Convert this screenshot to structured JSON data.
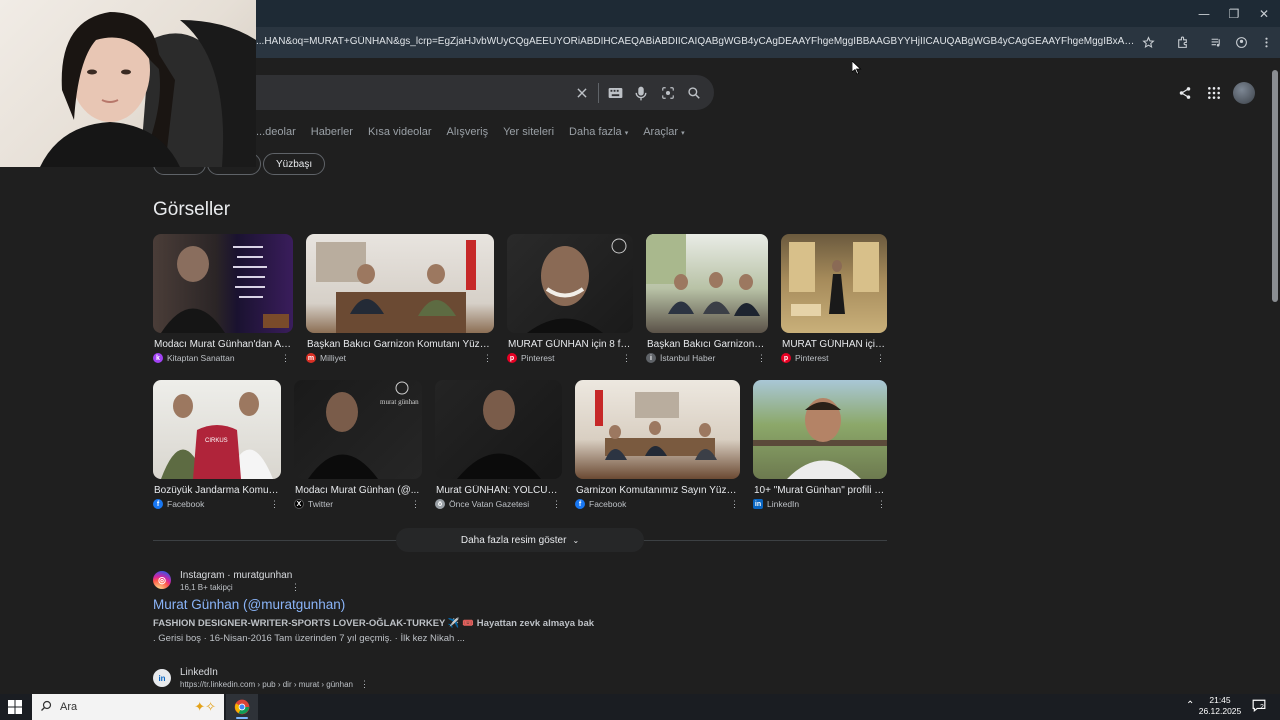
{
  "browser": {
    "url": "...HAN&oq=MURAT+GÜNHAN&gs_lcrp=EgZjaHJvbWUyCQgAEEUYORiABDIHCAEQABiABDIICAIQABgWGB4yCAgDEAAYFhgeMggIBBAAGBYYHjIICAUQABgWGB4yCAgGEAAYFhgeMggIBxAAGBYYHjIHCAgQABjvBTIH..."
  },
  "search": {
    "nav_tabs": [
      "...deolar",
      "Haberler",
      "Kısa videolar",
      "Alışveriş",
      "Yer siteleri",
      "Daha fazla",
      "Araçlar"
    ],
    "chips": [
      "Model",
      "Bakıcı",
      "Yüzbaşı"
    ]
  },
  "images_section": {
    "title": "Görseller",
    "rows": [
      [
        {
          "caption": "Modacı Murat Günhan'dan Anl...",
          "source": "Kitaptan Sanattan",
          "source_color": "#a142f4"
        },
        {
          "caption": "Başkan Bakıcı Garnizon Komutanı Yüzba...",
          "source": "Milliyet",
          "source_color": "#d93025"
        },
        {
          "caption": "MURAT GÜNHAN için 8 fikir",
          "source": "Pinterest",
          "source_color": "#e60023"
        },
        {
          "caption": "Başkan Bakıcı Garnizon K...",
          "source": "İstanbul Haber",
          "source_color": "#5f6368"
        },
        {
          "caption": "MURAT GÜNHAN için...",
          "source": "Pinterest",
          "source_color": "#e60023"
        }
      ],
      [
        {
          "caption": "Bozüyük Jandarma Komuta...",
          "source": "Facebook",
          "source_color": "#1877f2"
        },
        {
          "caption": "Modacı Murat Günhan (@...",
          "source": "Twitter",
          "source_color": "#000000"
        },
        {
          "caption": "Murat GÜNHAN: YOLCUL...",
          "source": "Önce Vatan Gazetesi",
          "source_color": "#9aa0a6"
        },
        {
          "caption": "Garnizon Komutanımız Sayın Yüzba...",
          "source": "Facebook",
          "source_color": "#1877f2"
        },
        {
          "caption": "10+ \"Murat Günhan\" profili | L...",
          "source": "LinkedIn",
          "source_color": "#0a66c2"
        }
      ]
    ],
    "more_button": "Daha fazla resim göster"
  },
  "results": [
    {
      "site": "Instagram · muratgunhan",
      "followers": "16,1 B+ takipçi",
      "title": "Murat Günhan (@muratgunhan)",
      "snippet_line1": "FASHION DESIGNER-WRITER-SPORTS LOVER-OĞLAK-TURKEY ✈️ 🎟️ Hayattan zevk almaya bak",
      "snippet_line2": ". Gerisi boş · 16-Nisan-2016 Tam üzerinden 7 yıl geçmiş. · İlk kez Nikah ..."
    },
    {
      "site": "LinkedIn",
      "breadcrumb": "https://tr.linkedin.com › pub › dir › murat › günhan"
    }
  ],
  "taskbar": {
    "search_placeholder": "Ara",
    "time": "21:45",
    "date": "26.12.2025",
    "notification_count": "2"
  }
}
